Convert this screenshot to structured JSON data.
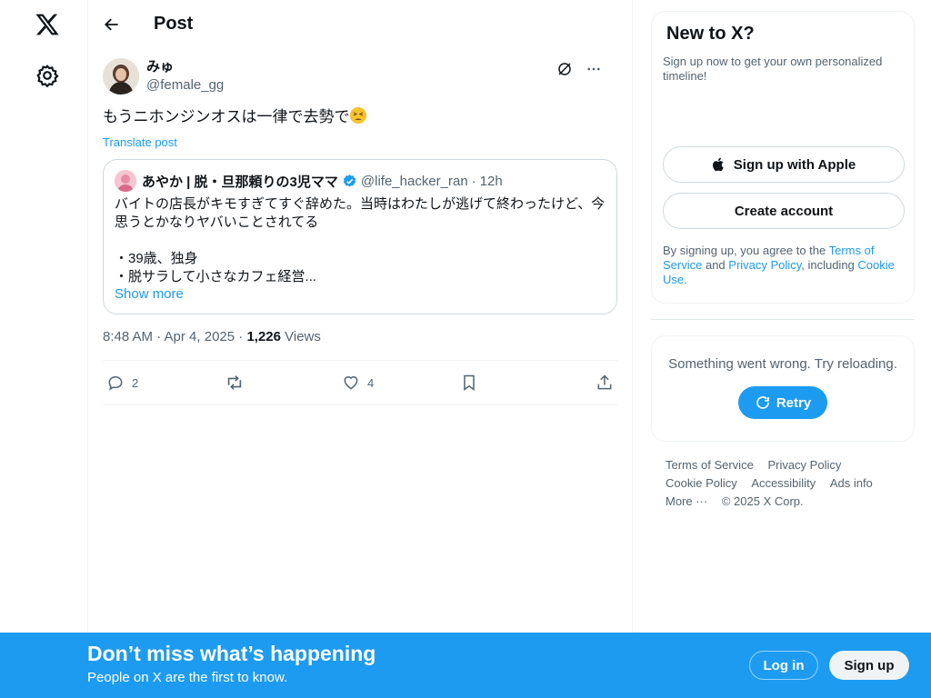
{
  "nav": {
    "logo_icon": "x-logo-icon",
    "settings_icon": "gear-icon"
  },
  "header": {
    "title": "Post"
  },
  "post": {
    "author_name": "みゅ",
    "author_handle": "@female_gg",
    "text": "もうニホンジンオスは一律で去勢で",
    "emoji": "tired-face-emoji",
    "translate_label": "Translate post",
    "quote": {
      "author_name": "あやか | 脱・旦那頼りの3児ママ",
      "author_handle": "@life_hacker_ran",
      "separator": "·",
      "time": "12h",
      "text": "バイトの店長がキモすぎてすぐ辞めた。当時はわたしが逃げて終わったけど、今思うとかなりヤバいことされてる\n\n・39歳、独身\n・脱サラして小さなカフェ経営...",
      "show_more": "Show more"
    },
    "timestamp": "8:48 AM · Apr 4, 2025 · ",
    "views_count": "1,226",
    "views_label": " Views",
    "replies": "2",
    "likes": "4"
  },
  "sidebar": {
    "new_title": "New to X?",
    "new_sub": "Sign up now to get your own personalized timeline!",
    "apple_label": "Sign up with Apple",
    "create_label": "Create account",
    "legal_prefix": "By signing up, you agree to the ",
    "legal_terms": "Terms of Service",
    "legal_and": " and ",
    "legal_privacy": "Privacy Policy",
    "legal_including": ", including ",
    "legal_cookie": "Cookie Use.",
    "error_text": "Something went wrong. Try reloading.",
    "retry_label": "Retry",
    "footer": {
      "terms": "Terms of Service",
      "privacy": "Privacy Policy",
      "cookie": "Cookie Policy",
      "accessibility": "Accessibility",
      "ads": "Ads info",
      "more": "More ···",
      "copyright": "© 2025 X Corp."
    }
  },
  "banner": {
    "title": "Don’t miss what’s happening",
    "subtitle": "People on X are the first to know.",
    "login": "Log in",
    "signup": "Sign up"
  },
  "colors": {
    "accent": "#1d9bf0",
    "text": "#0f1419",
    "muted": "#536471",
    "border": "#eff3f4"
  }
}
